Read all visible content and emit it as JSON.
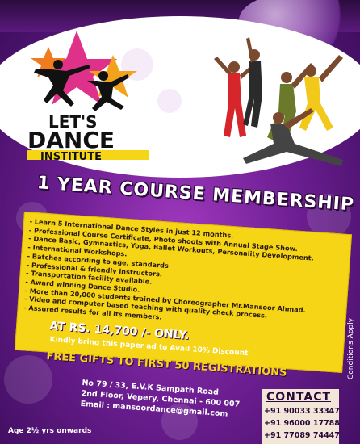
{
  "logo": {
    "line1": "LET'S",
    "line2": "DANCE",
    "line3": "INSTITUTE"
  },
  "headline": "1 YEAR COURSE MEMBERSHIP",
  "features": [
    "- Learn 5 International Dance Styles in just 12 months.",
    "- Professional Course Certificate, Photo shoots with Annual Stage Show.",
    "- Dance Basic, Gymnastics, Yoga, Ballet Workouts, Personality Development.",
    "- International Workshops.",
    "- Batches according to age, standards",
    "- Professional & friendly instructors.",
    "- Transportation facility available.",
    "- Award winning Dance Studio.",
    "- More than 20,000 students trained by Choreographer Mr.Mansoor Ahmad.",
    "- Video and computer based teaching with quality check process.",
    "- Assured results for all its members."
  ],
  "price": "AT RS. 14,700 /- ONLY.",
  "discount_note": "Kindly bring this paper ad to Avail 10% Discount",
  "gifts": "FREE GIFTS TO FIRST 50 REGISTRATIONS",
  "address": {
    "line1": "No 79 / 33, E.V.K Sampath Road",
    "line2": "2nd Floor, Vepery, Chennai - 600 007",
    "email": "Email : mansoordance@gmail.com"
  },
  "contact": {
    "title": "CONTACT",
    "phones": [
      "+91 90033 33347",
      "+91 96000 17788",
      "+91 77089 74447"
    ]
  },
  "conditions": "Conditions Apply",
  "age": "Age 2½ yrs onwards",
  "colors": {
    "purple": "#6e1f93",
    "yellow": "#f5d515",
    "pink": "#e0318a",
    "dark": "#2a0838"
  }
}
